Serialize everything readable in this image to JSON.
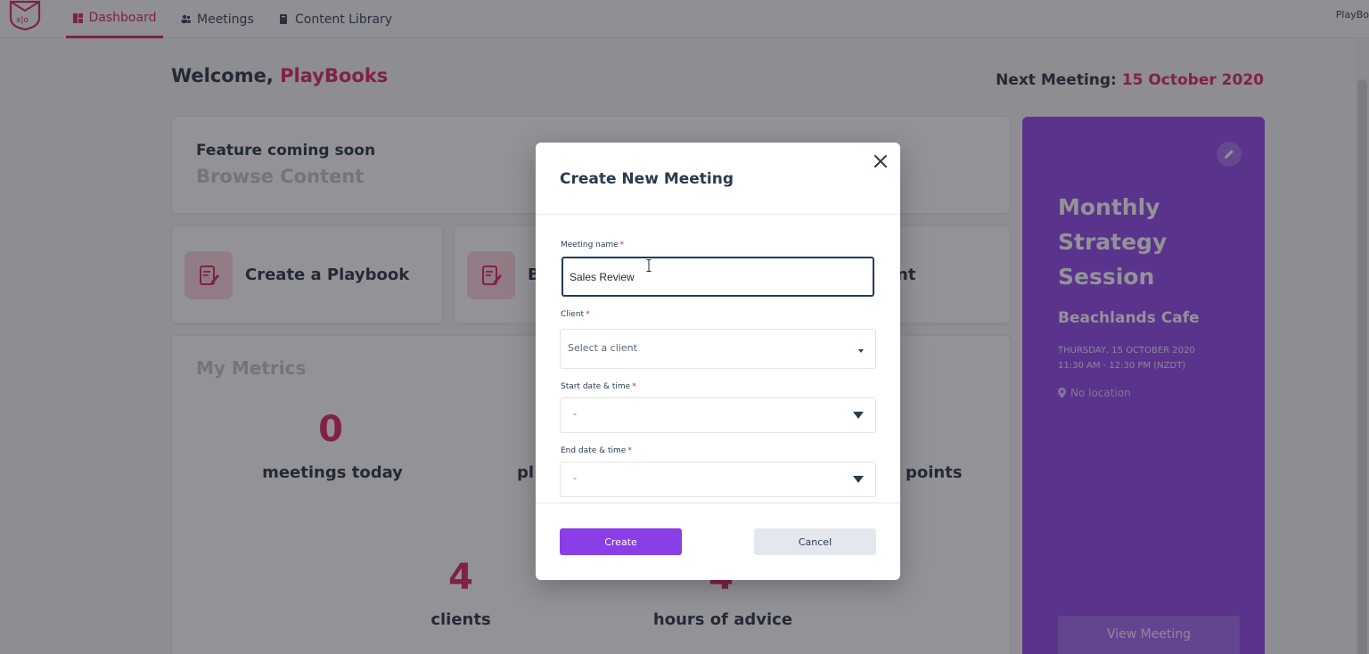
{
  "nav": {
    "items": [
      {
        "label": "Dashboard",
        "icon": "dashboard-icon",
        "active": true
      },
      {
        "label": "Meetings",
        "icon": "people-icon",
        "active": false
      },
      {
        "label": "Content Library",
        "icon": "book-icon",
        "active": false
      }
    ],
    "user_cut": "PlayBo"
  },
  "welcome": {
    "prefix": "Welcome, ",
    "name": "PlayBooks"
  },
  "next_meeting": {
    "label": "Next Meeting: ",
    "date": "15 October 2020"
  },
  "feature": {
    "title": "Feature coming soon",
    "subtitle": "Browse Content"
  },
  "actions": [
    {
      "label": "Create a Playbook",
      "icon": "document-edit-icon"
    },
    {
      "label": "B",
      "icon": "document-edit-icon"
    },
    {
      "label": "nt",
      "icon": ""
    }
  ],
  "metrics": {
    "title": "My Metrics",
    "items": [
      {
        "value": "0",
        "label": "meetings today"
      },
      {
        "value": "",
        "label": "pl"
      },
      {
        "value": "",
        "label": "points"
      },
      {
        "value": "4",
        "label": "clients"
      },
      {
        "value": "4",
        "label": "hours of advice"
      }
    ]
  },
  "meeting_panel": {
    "title": "Monthly Strategy Session",
    "venue": "Beachlands Cafe",
    "date_line": "THURSDAY, 15 OCTOBER 2020",
    "time_line": "11:30 AM - 12:30 PM (NZDT)",
    "location": "No location",
    "view_button": "View Meeting"
  },
  "modal": {
    "title": "Create New Meeting",
    "meeting_name_label": "Meeting name",
    "meeting_name_value": "Sales Review",
    "client_label": "Client",
    "client_placeholder": "Select a client",
    "start_label": "Start date & time",
    "start_value": "-",
    "end_label": "End date & time",
    "end_value": "-",
    "required_mark": "*",
    "create_label": "Create",
    "cancel_label": "Cancel"
  },
  "colors": {
    "accent_pink": "#d81b60",
    "accent_purple": "#8a3ee8",
    "text_dark": "#1e2a3a"
  }
}
